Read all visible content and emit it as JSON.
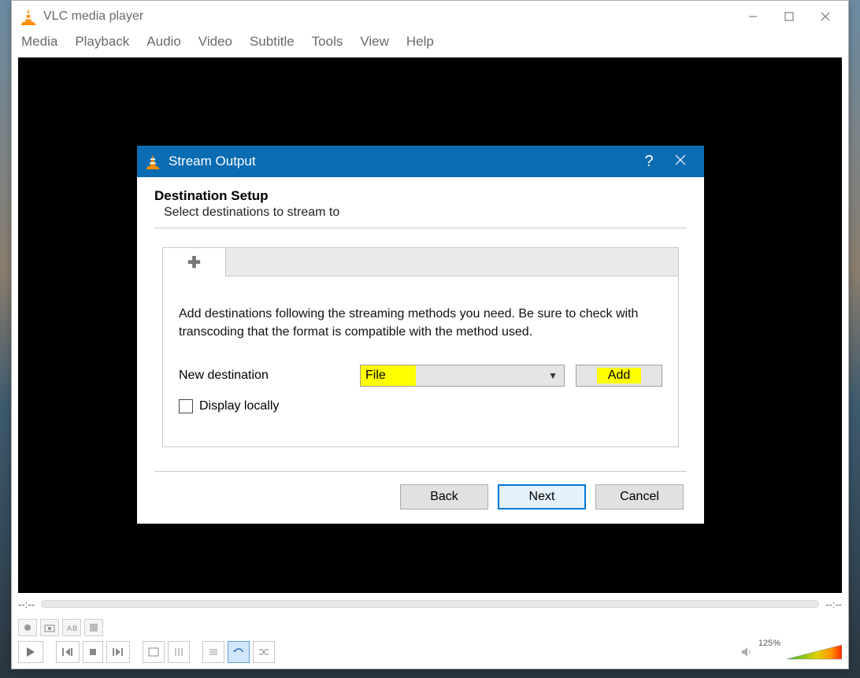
{
  "window": {
    "title": "VLC media player",
    "menu": [
      "Media",
      "Playback",
      "Audio",
      "Video",
      "Subtitle",
      "Tools",
      "View",
      "Help"
    ],
    "seek_left": "--:--",
    "seek_right": "--:--",
    "volume_label": "125%"
  },
  "dialog": {
    "title": "Stream Output",
    "heading": "Destination Setup",
    "subheading": "Select destinations to stream to",
    "tab_plus": "✚",
    "body_text": "Add destinations following the streaming methods you need. Be sure to check with transcoding that the format is compatible with the method used.",
    "new_dest_label": "New destination",
    "dest_selected": "File",
    "add_label": "Add",
    "display_locally_label": "Display locally",
    "buttons": {
      "back": "Back",
      "next": "Next",
      "cancel": "Cancel"
    }
  }
}
